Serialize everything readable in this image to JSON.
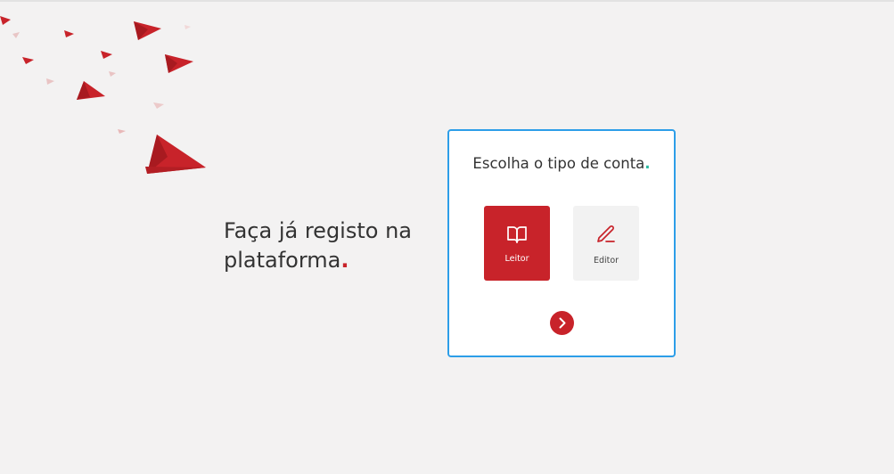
{
  "hero": {
    "title_main": "Faça já registo na plataforma",
    "title_dot": "."
  },
  "account_card": {
    "title_main": "Escolha o tipo de conta",
    "title_dot": ".",
    "options": [
      {
        "label": "Leitor",
        "icon": "book-icon",
        "selected": true
      },
      {
        "label": "Editor",
        "icon": "pencil-icon",
        "selected": false
      }
    ],
    "next_icon": "chevron-right-icon"
  },
  "decoration": {
    "icon": "paper-planes"
  },
  "colors": {
    "background": "#f3f2f2",
    "accent_red": "#c8232a",
    "accent_teal": "#2bb9a1",
    "card_border": "#2d9ee8",
    "text": "#333333"
  }
}
